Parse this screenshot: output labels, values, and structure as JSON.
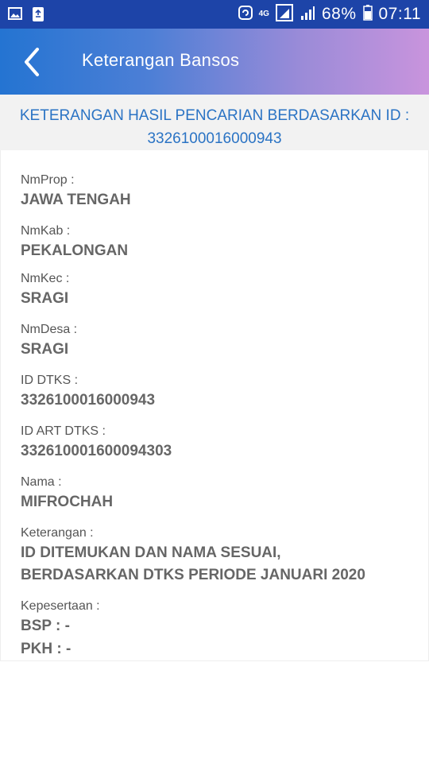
{
  "status_bar": {
    "network": "4G",
    "battery": "68%",
    "time": "07:11"
  },
  "app_bar": {
    "title": "Keterangan Bansos"
  },
  "result_heading": {
    "line1": "KETERANGAN HASIL PENCARIAN BERDASARKAN ID :",
    "line2": "3326100016000943"
  },
  "details": {
    "nmprop": {
      "label": "NmProp :",
      "value": "JAWA TENGAH"
    },
    "nmkab": {
      "label": "NmKab :",
      "value": "PEKALONGAN"
    },
    "nmkec": {
      "label": "NmKec :",
      "value": "SRAGI"
    },
    "nmdesa": {
      "label": "NmDesa :",
      "value": "SRAGI"
    },
    "id_dtks": {
      "label": "ID DTKS :",
      "value": "3326100016000943"
    },
    "id_art_dtks": {
      "label": "ID ART DTKS :",
      "value": "332610001600094303"
    },
    "nama": {
      "label": "Nama :",
      "value": "MIFROCHAH"
    },
    "keterangan": {
      "label": "Keterangan :",
      "value_line1": "ID DITEMUKAN DAN NAMA SESUAI,",
      "value_line2": "BERDASARKAN DTKS PERIODE JANUARI 2020"
    },
    "kepesertaan": {
      "label": "Kepesertaan :",
      "bsp": "BSP : -",
      "pkh": "PKH : -"
    }
  }
}
